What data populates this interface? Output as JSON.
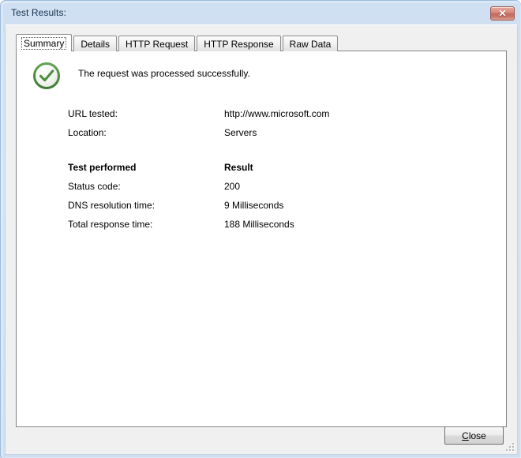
{
  "window": {
    "title": "Test Results:",
    "close_icon": "close-icon",
    "close_glyph": "✕"
  },
  "tabs": [
    {
      "label": "Summary",
      "active": true
    },
    {
      "label": "Details",
      "active": false
    },
    {
      "label": "HTTP Request",
      "active": false
    },
    {
      "label": "HTTP Response",
      "active": false
    },
    {
      "label": "Raw Data",
      "active": false
    }
  ],
  "summary": {
    "status_icon": "success-check-icon",
    "status_message": "The request was processed successfully.",
    "info": [
      {
        "label": "URL tested:",
        "value": "http://www.microsoft.com"
      },
      {
        "label": "Location:",
        "value": "Servers"
      }
    ],
    "results_header": {
      "label": "Test performed",
      "value": "Result"
    },
    "results": [
      {
        "label": "Status code:",
        "value": "200"
      },
      {
        "label": "DNS resolution time:",
        "value": "9 Milliseconds"
      },
      {
        "label": "Total response time:",
        "value": "188 Milliseconds"
      }
    ]
  },
  "footer": {
    "close_button": {
      "accel": "C",
      "rest": "lose"
    }
  },
  "colors": {
    "frame": "#cfe0f2",
    "client": "#f0f0f0",
    "panel": "#ffffff",
    "success_green": "#4a8f3c",
    "close_red": "#c4685c"
  }
}
